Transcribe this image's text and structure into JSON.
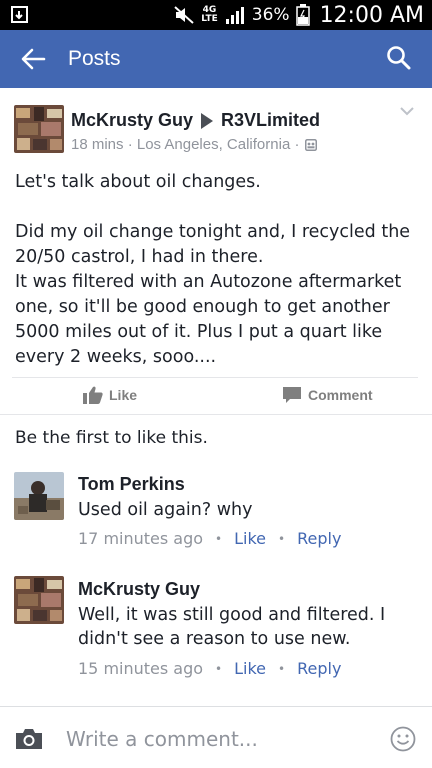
{
  "status_bar": {
    "lte": "4G\nLTE",
    "battery": "36%",
    "time": "12:00 AM"
  },
  "app_bar": {
    "title": "Posts",
    "back_icon": "arrow-left-icon",
    "search_icon": "search-icon",
    "color": "#4267b2"
  },
  "post": {
    "author": "McKrusty Guy",
    "target": "R3VLimited",
    "meta": "18 mins · Los Angeles, California ·",
    "privacy_icon": "group-icon",
    "lines": [
      "Let's talk about oil changes.",
      "",
      "Did my oil change tonight and, I recycled the 20/50 castrol, I had in there.",
      "It was filtered with an Autozone aftermarket one, so it'll be good enough to get another 5000 miles out of it. Plus I put a quart like every 2 weeks, sooo...."
    ],
    "like_label": "Like",
    "comment_label": "Comment"
  },
  "likes_summary": "Be the first to like this.",
  "comments": [
    {
      "author": "Tom Perkins",
      "text": "Used oil again? why",
      "time": "17 minutes ago",
      "like": "Like",
      "reply": "Reply"
    },
    {
      "author": "McKrusty Guy",
      "text": "Well, it was still good and filtered. I didn't see a reason to use new.",
      "time": "15 minutes ago",
      "like": "Like",
      "reply": "Reply"
    }
  ],
  "composer": {
    "placeholder": "Write a comment...",
    "camera_icon": "camera-icon",
    "emoji_icon": "smiley-icon"
  },
  "colors": {
    "accent": "#4267b2",
    "text": "#1d2129",
    "muted": "#90949c"
  }
}
